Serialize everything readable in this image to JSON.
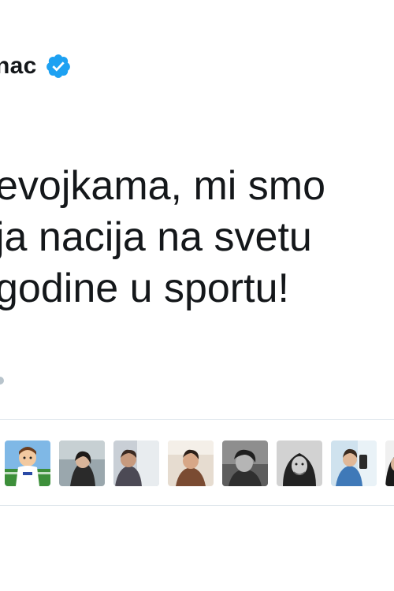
{
  "tweet": {
    "author_name": "nac",
    "verified_icon": "verified-badge-icon",
    "text_lines": [
      "evojkama, mi smo",
      "ja nacija na svetu",
      "godine u sportu!"
    ]
  },
  "likers": {
    "avatars": [
      {
        "icon": "avatar-cartoon"
      },
      {
        "icon": "avatar-photo"
      },
      {
        "icon": "avatar-photo"
      },
      {
        "icon": "avatar-photo"
      },
      {
        "icon": "avatar-photo"
      },
      {
        "icon": "avatar-photo"
      },
      {
        "icon": "avatar-photo"
      },
      {
        "icon": "avatar-photo"
      },
      {
        "icon": "avatar-photo"
      }
    ]
  },
  "colors": {
    "verified_blue": "#1da1f2",
    "divider": "#e1e8ed",
    "text": "#14171a"
  }
}
